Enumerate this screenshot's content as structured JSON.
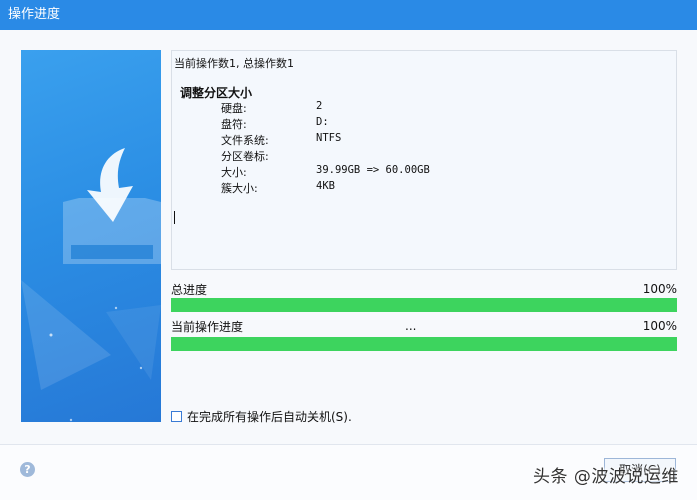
{
  "window": {
    "title": "操作进度"
  },
  "log": {
    "header": "当前操作数1, 总操作数1",
    "operation_title": "调整分区大小",
    "fields": [
      {
        "key": "硬盘:",
        "value": "2"
      },
      {
        "key": "盘符:",
        "value": "D:"
      },
      {
        "key": "文件系统:",
        "value": "NTFS"
      },
      {
        "key": "分区卷标:",
        "value": ""
      },
      {
        "key": "大小:",
        "value": "39.99GB => 60.00GB"
      },
      {
        "key": "簇大小:",
        "value": "4KB"
      }
    ]
  },
  "progress": {
    "total_label": "总进度",
    "total_percent_text": "100%",
    "total_fraction": 1.0,
    "current_label": "当前操作进度",
    "current_status": "...",
    "current_percent_text": "100%",
    "current_fraction": 1.0
  },
  "options": {
    "shutdown_label": "在完成所有操作后自动关机(S)."
  },
  "footer": {
    "help_symbol": "?",
    "cancel_label": "取消(C)",
    "watermark": "头条 @波波说运维"
  },
  "colors": {
    "titlebar": "#2a8ae6",
    "progress_fill": "#3dd45e",
    "side_panel": "#2b8ee4"
  }
}
